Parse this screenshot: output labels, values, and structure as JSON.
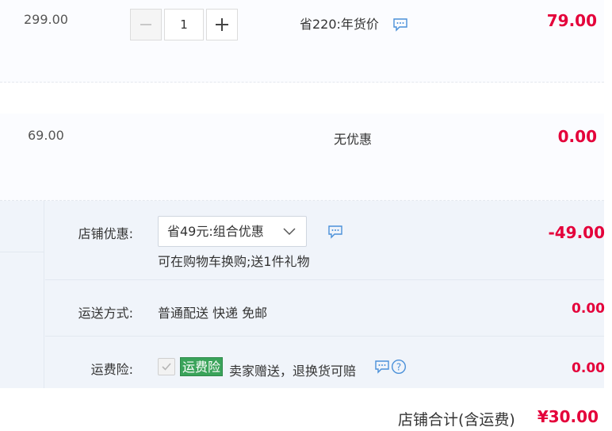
{
  "items": [
    {
      "original_price": "299.00",
      "quantity": "1",
      "promotion": "省220:年货价",
      "subtotal": "79.00"
    },
    {
      "original_price": "69.00",
      "promotion": "无优惠",
      "subtotal": "0.00"
    }
  ],
  "shop": {
    "discount_label": "店铺优惠:",
    "discount_selected": "省49元:组合优惠",
    "discount_note": "可在购物车换购;送1件礼物",
    "discount_amount": "-49.00",
    "shipping_label": "运送方式:",
    "shipping_value": "普通配送 快递 免邮",
    "shipping_amount": "0.00",
    "insurance_label": "运费险:",
    "insurance_tag": "运费险",
    "insurance_text": "卖家赠送，退换货可赔",
    "insurance_amount": "0.00"
  },
  "total": {
    "label": "店铺合计(含运费)",
    "value": "¥30.00"
  },
  "colors": {
    "price_red": "#e4003a",
    "section_bg": "#f0f4fa",
    "tag_green": "#3aa35a",
    "icon_blue": "#4a90d9"
  },
  "icons": [
    "minus-icon",
    "plus-icon",
    "message-icon",
    "chevron-down-icon",
    "check-icon",
    "help-icon"
  ]
}
